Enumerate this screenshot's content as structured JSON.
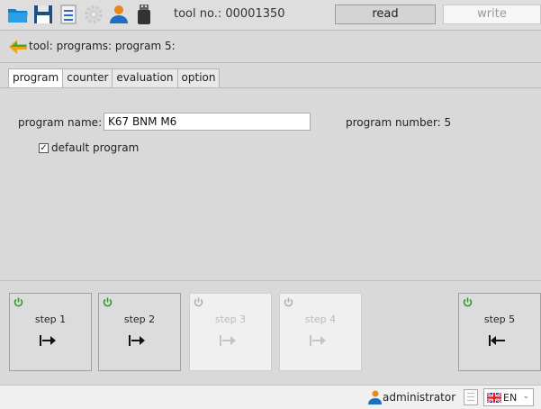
{
  "toolbar": {
    "tool_no": "tool no.: 00001350",
    "read_label": "read",
    "write_label": "write",
    "icons": [
      "folder-open-icon",
      "save-icon",
      "print-icon",
      "settings-gear-icon",
      "user-icon",
      "usb-drive-icon"
    ]
  },
  "breadcrumb": {
    "text": "tool: programs: program 5:"
  },
  "tabs": [
    "program",
    "counter",
    "evaluation",
    "option"
  ],
  "form": {
    "program_name_label": "program name:",
    "program_name_value": "K67 BNM M6",
    "program_number_label": "program number:  5",
    "default_program_label": "default program",
    "default_program_checked": true
  },
  "steps": [
    {
      "label": "step 1",
      "enabled": true,
      "direction": "right"
    },
    {
      "label": "step 2",
      "enabled": true,
      "direction": "right"
    },
    {
      "label": "step 3",
      "enabled": false,
      "direction": "right"
    },
    {
      "label": "step 4",
      "enabled": false,
      "direction": "right"
    },
    {
      "label": "step 5",
      "enabled": true,
      "direction": "left"
    }
  ],
  "status": {
    "user": "administrator",
    "language": "EN"
  },
  "colors": {
    "power_on": "#2e9b2e",
    "power_off": "#b0b0b0",
    "accent_orange": "#e8871c",
    "accent_blue": "#1d6fc4"
  }
}
